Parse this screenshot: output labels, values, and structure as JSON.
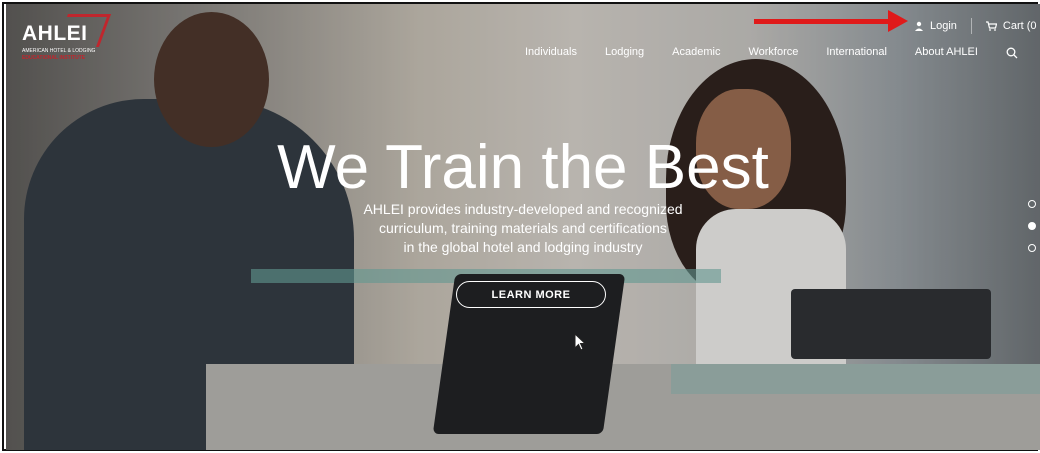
{
  "logo": {
    "name": "AHLEI",
    "line1": "AMERICAN HOTEL & LODGING",
    "line2": "EDUCATIONAL INSTITUTE"
  },
  "topbar": {
    "login_label": "Login",
    "cart_label": "Cart (0"
  },
  "nav": {
    "items": [
      "Individuals",
      "Lodging",
      "Academic",
      "Workforce",
      "International",
      "About AHLEI"
    ]
  },
  "hero": {
    "headline": "We Train the Best",
    "sub_line1": "AHLEI provides industry-developed and recognized",
    "sub_line2": "curriculum, training materials and certifications",
    "sub_line3": "in the global hotel and lodging industry",
    "cta_label": "LEARN MORE"
  },
  "carousel": {
    "slides": 3,
    "active_index": 1
  },
  "colors": {
    "brand_red": "#c0262d",
    "annotation_arrow": "#e01a1a",
    "text": "#ffffff"
  },
  "icons": [
    "user-icon",
    "cart-icon",
    "search-icon"
  ]
}
